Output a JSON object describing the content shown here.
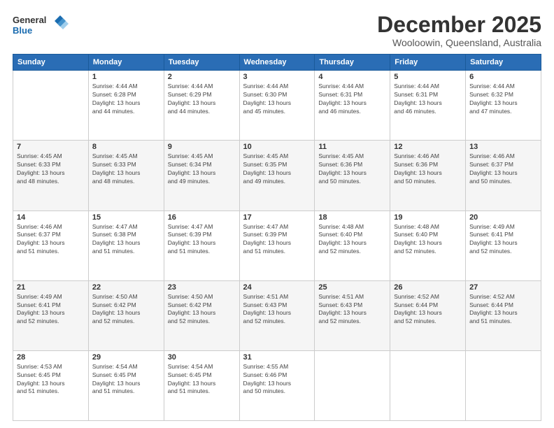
{
  "header": {
    "logo_line1": "General",
    "logo_line2": "Blue",
    "title": "December 2025",
    "subtitle": "Wooloowin, Queensland, Australia"
  },
  "days": [
    "Sunday",
    "Monday",
    "Tuesday",
    "Wednesday",
    "Thursday",
    "Friday",
    "Saturday"
  ],
  "weeks": [
    [
      {
        "date": "",
        "info": ""
      },
      {
        "date": "1",
        "info": "Sunrise: 4:44 AM\nSunset: 6:28 PM\nDaylight: 13 hours\nand 44 minutes."
      },
      {
        "date": "2",
        "info": "Sunrise: 4:44 AM\nSunset: 6:29 PM\nDaylight: 13 hours\nand 44 minutes."
      },
      {
        "date": "3",
        "info": "Sunrise: 4:44 AM\nSunset: 6:30 PM\nDaylight: 13 hours\nand 45 minutes."
      },
      {
        "date": "4",
        "info": "Sunrise: 4:44 AM\nSunset: 6:31 PM\nDaylight: 13 hours\nand 46 minutes."
      },
      {
        "date": "5",
        "info": "Sunrise: 4:44 AM\nSunset: 6:31 PM\nDaylight: 13 hours\nand 46 minutes."
      },
      {
        "date": "6",
        "info": "Sunrise: 4:44 AM\nSunset: 6:32 PM\nDaylight: 13 hours\nand 47 minutes."
      }
    ],
    [
      {
        "date": "7",
        "info": "Sunrise: 4:45 AM\nSunset: 6:33 PM\nDaylight: 13 hours\nand 48 minutes."
      },
      {
        "date": "8",
        "info": "Sunrise: 4:45 AM\nSunset: 6:33 PM\nDaylight: 13 hours\nand 48 minutes."
      },
      {
        "date": "9",
        "info": "Sunrise: 4:45 AM\nSunset: 6:34 PM\nDaylight: 13 hours\nand 49 minutes."
      },
      {
        "date": "10",
        "info": "Sunrise: 4:45 AM\nSunset: 6:35 PM\nDaylight: 13 hours\nand 49 minutes."
      },
      {
        "date": "11",
        "info": "Sunrise: 4:45 AM\nSunset: 6:36 PM\nDaylight: 13 hours\nand 50 minutes."
      },
      {
        "date": "12",
        "info": "Sunrise: 4:46 AM\nSunset: 6:36 PM\nDaylight: 13 hours\nand 50 minutes."
      },
      {
        "date": "13",
        "info": "Sunrise: 4:46 AM\nSunset: 6:37 PM\nDaylight: 13 hours\nand 50 minutes."
      }
    ],
    [
      {
        "date": "14",
        "info": "Sunrise: 4:46 AM\nSunset: 6:37 PM\nDaylight: 13 hours\nand 51 minutes."
      },
      {
        "date": "15",
        "info": "Sunrise: 4:47 AM\nSunset: 6:38 PM\nDaylight: 13 hours\nand 51 minutes."
      },
      {
        "date": "16",
        "info": "Sunrise: 4:47 AM\nSunset: 6:39 PM\nDaylight: 13 hours\nand 51 minutes."
      },
      {
        "date": "17",
        "info": "Sunrise: 4:47 AM\nSunset: 6:39 PM\nDaylight: 13 hours\nand 51 minutes."
      },
      {
        "date": "18",
        "info": "Sunrise: 4:48 AM\nSunset: 6:40 PM\nDaylight: 13 hours\nand 52 minutes."
      },
      {
        "date": "19",
        "info": "Sunrise: 4:48 AM\nSunset: 6:40 PM\nDaylight: 13 hours\nand 52 minutes."
      },
      {
        "date": "20",
        "info": "Sunrise: 4:49 AM\nSunset: 6:41 PM\nDaylight: 13 hours\nand 52 minutes."
      }
    ],
    [
      {
        "date": "21",
        "info": "Sunrise: 4:49 AM\nSunset: 6:41 PM\nDaylight: 13 hours\nand 52 minutes."
      },
      {
        "date": "22",
        "info": "Sunrise: 4:50 AM\nSunset: 6:42 PM\nDaylight: 13 hours\nand 52 minutes."
      },
      {
        "date": "23",
        "info": "Sunrise: 4:50 AM\nSunset: 6:42 PM\nDaylight: 13 hours\nand 52 minutes."
      },
      {
        "date": "24",
        "info": "Sunrise: 4:51 AM\nSunset: 6:43 PM\nDaylight: 13 hours\nand 52 minutes."
      },
      {
        "date": "25",
        "info": "Sunrise: 4:51 AM\nSunset: 6:43 PM\nDaylight: 13 hours\nand 52 minutes."
      },
      {
        "date": "26",
        "info": "Sunrise: 4:52 AM\nSunset: 6:44 PM\nDaylight: 13 hours\nand 52 minutes."
      },
      {
        "date": "27",
        "info": "Sunrise: 4:52 AM\nSunset: 6:44 PM\nDaylight: 13 hours\nand 51 minutes."
      }
    ],
    [
      {
        "date": "28",
        "info": "Sunrise: 4:53 AM\nSunset: 6:45 PM\nDaylight: 13 hours\nand 51 minutes."
      },
      {
        "date": "29",
        "info": "Sunrise: 4:54 AM\nSunset: 6:45 PM\nDaylight: 13 hours\nand 51 minutes."
      },
      {
        "date": "30",
        "info": "Sunrise: 4:54 AM\nSunset: 6:45 PM\nDaylight: 13 hours\nand 51 minutes."
      },
      {
        "date": "31",
        "info": "Sunrise: 4:55 AM\nSunset: 6:46 PM\nDaylight: 13 hours\nand 50 minutes."
      },
      {
        "date": "",
        "info": ""
      },
      {
        "date": "",
        "info": ""
      },
      {
        "date": "",
        "info": ""
      }
    ]
  ]
}
